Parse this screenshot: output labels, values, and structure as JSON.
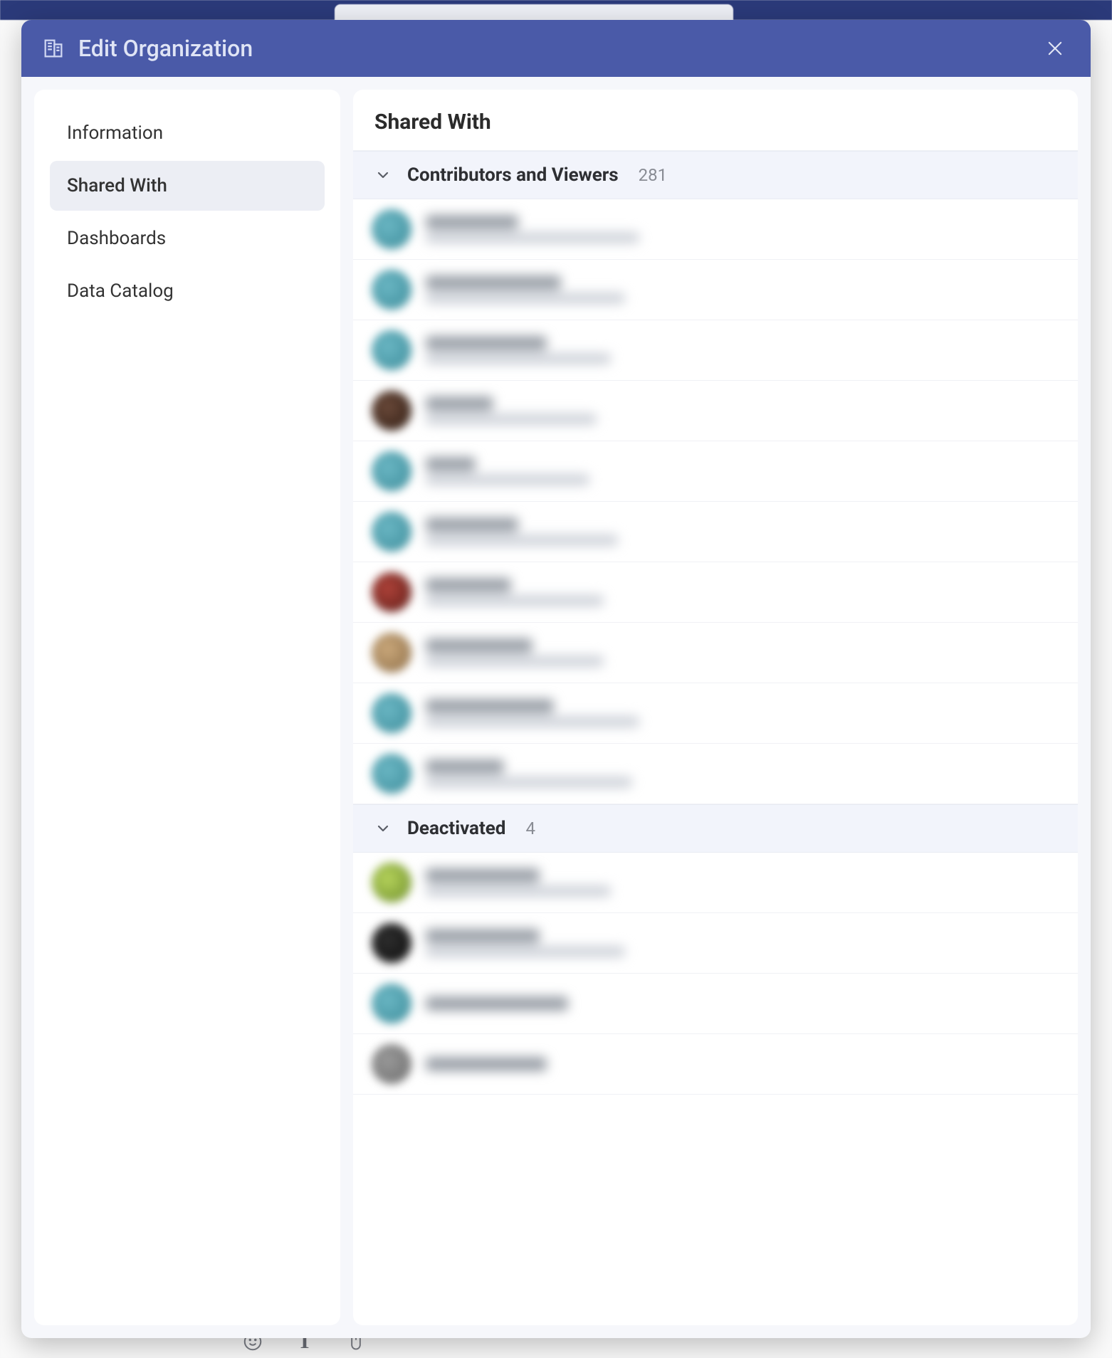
{
  "modal": {
    "title": "Edit Organization",
    "close_aria": "Close"
  },
  "sidebar": {
    "items": [
      {
        "label": "Information",
        "id": "nav-information",
        "active": false
      },
      {
        "label": "Shared With",
        "id": "nav-shared-with",
        "active": true
      },
      {
        "label": "Dashboards",
        "id": "nav-dashboards",
        "active": false
      },
      {
        "label": "Data Catalog",
        "id": "nav-data-catalog",
        "active": false
      }
    ]
  },
  "main": {
    "title": "Shared With",
    "sections": [
      {
        "id": "contributors",
        "label": "Contributors and Viewers",
        "count": "281",
        "expanded": true,
        "rows": [
          {
            "avatar_color": "b-teal",
            "name_w": 130,
            "sub_w": 300
          },
          {
            "avatar_color": "b-teal",
            "name_w": 190,
            "sub_w": 280
          },
          {
            "avatar_color": "b-teal",
            "name_w": 170,
            "sub_w": 260
          },
          {
            "avatar_color": "b-brown",
            "name_w": 95,
            "sub_w": 240
          },
          {
            "avatar_color": "b-teal",
            "name_w": 70,
            "sub_w": 230
          },
          {
            "avatar_color": "b-teal",
            "name_w": 130,
            "sub_w": 270
          },
          {
            "avatar_color": "b-red",
            "name_w": 120,
            "sub_w": 250
          },
          {
            "avatar_color": "b-tan",
            "name_w": 150,
            "sub_w": 250
          },
          {
            "avatar_color": "b-teal",
            "name_w": 180,
            "sub_w": 300
          },
          {
            "avatar_color": "b-teal",
            "name_w": 110,
            "sub_w": 290
          }
        ]
      },
      {
        "id": "deactivated",
        "label": "Deactivated",
        "count": "4",
        "expanded": true,
        "rows": [
          {
            "avatar_color": "b-green",
            "name_w": 160,
            "sub_w": 260
          },
          {
            "avatar_color": "b-dark",
            "name_w": 160,
            "sub_w": 280
          },
          {
            "avatar_color": "b-teal",
            "name_w": 200,
            "sub_w": 0
          },
          {
            "avatar_color": "b-gray",
            "name_w": 170,
            "sub_w": 0
          }
        ]
      }
    ]
  }
}
